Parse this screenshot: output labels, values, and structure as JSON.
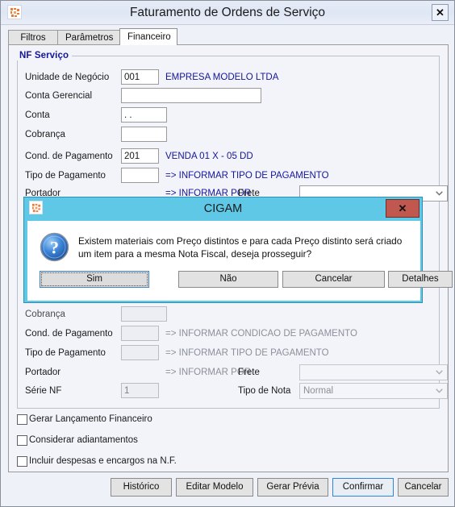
{
  "window": {
    "title": "Faturamento de Ordens de Serviço",
    "close_label": "✕",
    "app_icon": "cigam-app-icon"
  },
  "tabs": [
    {
      "label": "Filtros",
      "active": false
    },
    {
      "label": "Parâmetros",
      "active": false
    },
    {
      "label": "Financeiro",
      "active": true
    }
  ],
  "group": {
    "legend": "NF Serviço"
  },
  "fields": {
    "unidade_negocio": {
      "label": "Unidade de Negócio",
      "value": "001",
      "hint": "EMPRESA MODELO LTDA"
    },
    "conta_gerencial": {
      "label": "Conta Gerencial",
      "value": ""
    },
    "conta": {
      "label": "Conta",
      "value": ". ."
    },
    "cobranca": {
      "label": "Cobrança",
      "value": ""
    },
    "cond_pagamento": {
      "label": "Cond. de Pagamento",
      "value": "201",
      "hint": "VENDA 01 X - 05 DD"
    },
    "tipo_pagamento": {
      "label": "Tipo de Pagamento",
      "value": "",
      "hint": "=> INFORMAR TIPO DE PAGAMENTO"
    },
    "portador": {
      "label": "Portador",
      "hint": "=> INFORMAR POR",
      "combo_value": ""
    },
    "frete": {
      "label": "Frete",
      "combo_value": ""
    },
    "cobranca2": {
      "label": "Cobrança",
      "value": ""
    },
    "cond_pagamento2": {
      "label": "Cond. de Pagamento",
      "value": "",
      "hint": "=> INFORMAR CONDICAO DE PAGAMENTO"
    },
    "tipo_pagamento2": {
      "label": "Tipo de Pagamento",
      "value": "",
      "hint": "=> INFORMAR TIPO DE PAGAMENTO"
    },
    "portador2": {
      "label": "Portador",
      "hint": "=> INFORMAR POR",
      "combo_value": ""
    },
    "frete2": {
      "label": "Frete",
      "combo_value": ""
    },
    "serie_nf": {
      "label": "Série NF",
      "value": "1"
    },
    "tipo_nota": {
      "label": "Tipo de Nota",
      "combo_value": "Normal"
    }
  },
  "checkboxes": [
    {
      "label": "Gerar Lançamento Financeiro",
      "checked": false
    },
    {
      "label": "Considerar adiantamentos",
      "checked": false
    },
    {
      "label": "Incluir despesas e encargos na N.F.",
      "checked": false
    }
  ],
  "footer_buttons": [
    {
      "label": "Histórico",
      "accel": "H",
      "primary": false
    },
    {
      "label": "Editar Modelo",
      "accel": "E",
      "primary": false
    },
    {
      "label": "Gerar Prévia",
      "accel": "G",
      "primary": false
    },
    {
      "label": "Confirmar",
      "accel": "C",
      "primary": true
    },
    {
      "label": "Cancelar",
      "accel": "r",
      "primary": false
    }
  ],
  "dialog": {
    "title": "CIGAM",
    "close_label": "✕",
    "icon": "question-icon",
    "message": "Existem materiais com Preço distintos e para cada Preço distinto será criado um item para a mesma Nota Fiscal, deseja prosseguir?",
    "buttons": [
      {
        "label": "Sim",
        "accel": "S",
        "focused": true
      },
      {
        "label": "Não",
        "accel": "N",
        "focused": false
      },
      {
        "label": "Cancelar",
        "accel": "",
        "focused": false
      },
      {
        "label": "Detalhes",
        "accel": "D",
        "focused": false
      }
    ]
  },
  "colors": {
    "dialog_titlebar": "#5ec8e6",
    "dialog_close": "#c0584f",
    "hint_text": "#15159a",
    "legend_text": "#15159a",
    "window_bg": "#eef1f8"
  }
}
